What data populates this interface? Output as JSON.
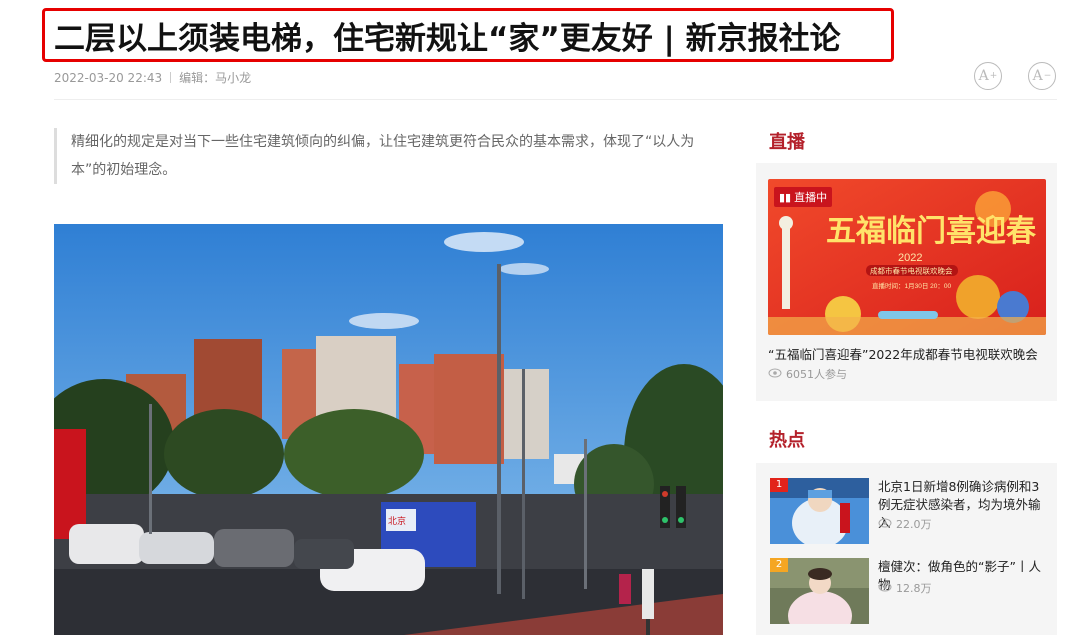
{
  "article": {
    "title": "二层以上须装电梯，住宅新规让“家”更友好 | 新京报社论",
    "date": "2022-03-20 22:43",
    "editor": "编辑：马小龙",
    "summary": "精细化的规定是对当下一些住宅建筑倾向的纠偏，让住宅建筑更符合民众的基本需求，体现了“以人为本”的初始理念。",
    "font_increase_label": "A",
    "font_decrease_label": "A",
    "photo_bus_sign": "北京"
  },
  "sidebar": {
    "live": {
      "heading": "直播",
      "badge": "直播中",
      "poster_title": "五福临门喜迎春",
      "poster_year": "2022",
      "poster_sub": "成都市春节电视联欢晚会",
      "poster_time": "直播时间：1月30日 20：00",
      "caption": "“五福临门喜迎春”2022年成都春节电视联欢晚会",
      "views": "6051人参与"
    },
    "hot": {
      "heading": "热点",
      "items": [
        {
          "rank": "1",
          "title": "北京1日新增8例确诊病例和3例无症状感染者，均为境外输入",
          "views": "22.0万"
        },
        {
          "rank": "2",
          "title": "檀健次：做角色的“影子”丨人物",
          "views": "12.8万"
        }
      ]
    }
  },
  "colors": {
    "accent": "#b4212b",
    "highlight_border": "#e60000",
    "rank1": "#e2231a",
    "rank2": "#f5a623"
  }
}
